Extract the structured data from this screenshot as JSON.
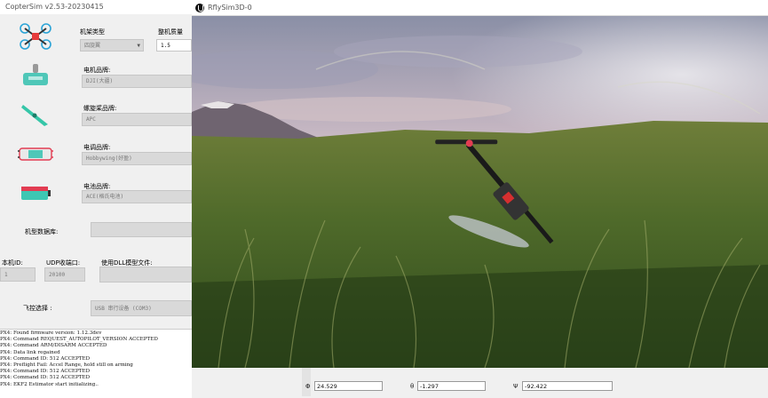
{
  "coptersim": {
    "title": "CopterSim v2.53-20230415",
    "frame_type_label": "机架类型",
    "frame_type_value": "四旋翼",
    "mass_label": "整机质量",
    "mass_value": "1.5",
    "motor_brand_label": "电机品牌:",
    "motor_brand_value": "DJI(大疆)",
    "prop_brand_label": "螺旋桨品牌:",
    "prop_brand_value": "APC",
    "esc_brand_label": "电调品牌:",
    "esc_brand_value": "Hobbywing(好盈)",
    "battery_brand_label": "电池品牌:",
    "battery_brand_value": "ACE(格氏电池)",
    "model_db_label": "机型数据库:",
    "model_db_value": "",
    "local_id_label": "本机ID:",
    "local_id_value": "1",
    "udp_port_label": "UDP收端口:",
    "udp_port_value": "20100",
    "dll_label": "使用DLL模型文件:",
    "dll_value": "",
    "fc_select_label": "飞控选择 :",
    "fc_select_value": "USB 串行设备 (COM3)"
  },
  "console_lines": [
    "PX4: Found firmware version: 1.12.3dev",
    "PX4: Command REQUEST_AUTOPILOT_VERSION ACCEPTED",
    "PX4: Command ARM/DISARM ACCEPTED",
    "PX4: Data link regained",
    "PX4: Command ID: 512 ACCEPTED",
    "PX4: Preflight Fail: Accel Range, hold still on arming",
    "PX4: Command ID: 512 ACCEPTED",
    "PX4: Command ID: 512 ACCEPTED",
    "PX4: EKF2 Estimator start initializing.."
  ],
  "rflysim": {
    "title": "RflySim3D-0"
  },
  "coords": {
    "phi_label": "Φ",
    "phi_value": "24.529",
    "theta_label": "θ",
    "theta_value": "-1.297",
    "psi_label": "Ψ",
    "psi_value": "-92.422"
  }
}
